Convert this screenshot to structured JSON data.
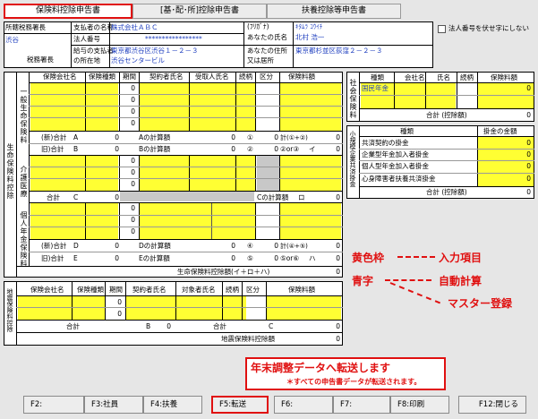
{
  "tabs": [
    "保険料控除申告書",
    "[基･配･所]控除申告書",
    "扶養控除等申告書"
  ],
  "hdr": {
    "shozoku": "所轄税務署長",
    "shibu": "渋谷",
    "zeimu": "税務署長",
    "shiharai_name_label": "支払者の名称",
    "shiharai_name": "株式会社ＡＢＣ",
    "hojin_label": "法人番号",
    "hojin_value": "*****************",
    "kyuyo_label": "給与の支払者",
    "shozaichi_label": "の所在地",
    "addr1": "東京都渋谷区渋谷１－２－３",
    "addr2": "渋谷センタービル",
    "furigana_label": "(ﾌﾘｶﾞﾅ)",
    "furigana": "ｷﾀﾑﾗ ｺｳｲﾁ",
    "name_label": "あなたの氏名",
    "name": "北村 浩一",
    "addr_label1": "あなたの住所",
    "addr_label2": "又は居所",
    "my_addr": "東京都杉並区荻窪２－２－３",
    "checkbox_label": "法人番号を伏せ字にしない"
  },
  "life": {
    "section": "生命保険料控除",
    "ippan": "一般生命保険料",
    "iryo": "介護医療",
    "nenkin": "個人年金保険料",
    "cols": [
      "保険会社名",
      "保険種類",
      "期間",
      "契約者氏名",
      "受取人氏名",
      "続柄",
      "区分",
      "保険料額"
    ],
    "zero": "0",
    "r_new": "(新)合計",
    "r_old": "旧)合計",
    "A": "A",
    "B": "B",
    "C": "C",
    "D": "D",
    "E": "E",
    "a_calc": "Aの計算額",
    "b_calc": "Bの計算額",
    "c_calc": "Cの計算額",
    "d_calc": "Dの計算額",
    "e_calc": "Eの計算額",
    "n1": "①",
    "n2": "②",
    "n3": "③",
    "n4": "④",
    "n5": "⑤",
    "k1": "計(①+②)",
    "k2": "②or③",
    "k3": "計(④+⑤)",
    "k4": "⑤or⑥",
    "i": "イ",
    "ro": "ロ",
    "ni": "ニ",
    "ha": "ハ",
    "goukei": "合計",
    "total": "生命保険料控除額(イ＋ロ＋ハ)"
  },
  "social": {
    "title": "社会保険料",
    "cols": [
      "種類",
      "会社名",
      "氏名",
      "続柄",
      "保険料額"
    ],
    "row1": "国民年金",
    "total": "合計 (控除額)",
    "zero": "0"
  },
  "small": {
    "title": "小規模企業共済掛金",
    "col1": "種類",
    "col2": "掛金の金額",
    "rows": [
      "共済契約の掛金",
      "企業型年金加入者掛金",
      "個人型年金加入者掛金",
      "心身障害者扶養共済掛金"
    ],
    "total": "合計 (控除額)",
    "zero": "0"
  },
  "eq": {
    "title": "地震保険料控除",
    "cols": [
      "保険会社名",
      "保険種類",
      "期間",
      "契約者氏名",
      "対象者氏名",
      "続柄",
      "区分",
      "保険料額"
    ],
    "goukei": "合計",
    "B": "B",
    "C": "C",
    "zero": "0",
    "total": "地震保険料控除額"
  },
  "ann": {
    "l1a": "黄色枠",
    "l1b": "入力項目",
    "l2a": "青字",
    "l2b": "自動計算",
    "l3": "マスター登録",
    "c1": "年末調整データへ転送します",
    "c2": "＊すべての申告書データが転送されます。"
  },
  "fkeys": [
    "F2:",
    "F3:社員",
    "F4:扶養",
    "F5:転送",
    "F6:",
    "F7:",
    "F8:印刷",
    "F12:閉じる"
  ],
  "colors": {
    "yellow": "#ffff33",
    "red": "#e01010",
    "blue": "#1f3fbf"
  }
}
